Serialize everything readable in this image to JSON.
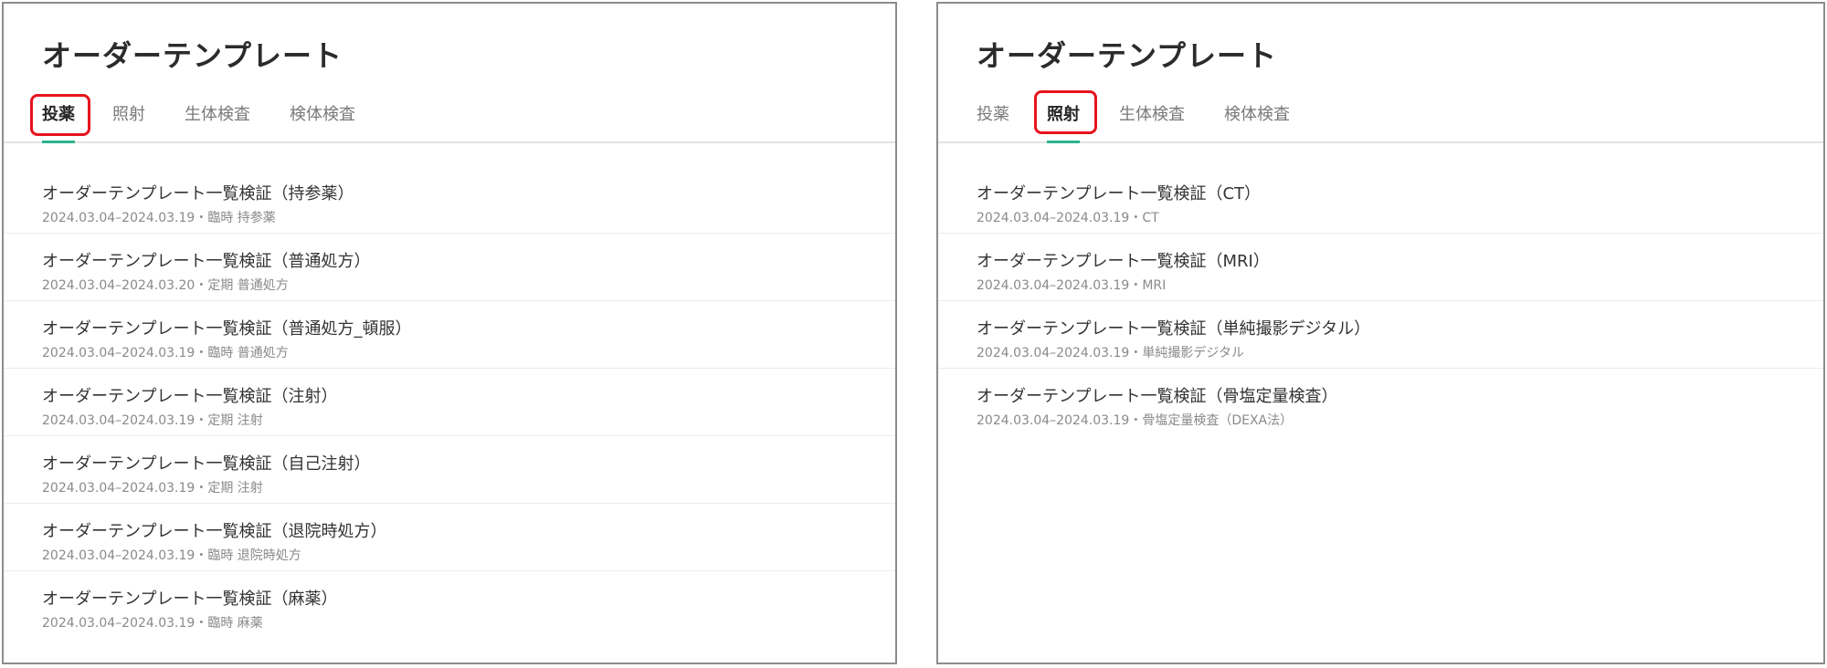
{
  "colors": {
    "accent": "#2bb38f",
    "highlight": "#e6141e",
    "border": "#8c8c8c"
  },
  "panels": [
    {
      "title": "オーダーテンプレート",
      "active_tab": "投薬",
      "tabs": [
        "投薬",
        "照射",
        "生体検査",
        "検体検査"
      ],
      "items": [
        {
          "title": "オーダーテンプレート一覧検証（持参薬）",
          "meta": "2024.03.04–2024.03.19・臨時 持参薬"
        },
        {
          "title": "オーダーテンプレート一覧検証（普通処方）",
          "meta": "2024.03.04–2024.03.20・定期 普通処方"
        },
        {
          "title": "オーダーテンプレート一覧検証（普通処方_頓服）",
          "meta": "2024.03.04–2024.03.19・臨時 普通処方"
        },
        {
          "title": "オーダーテンプレート一覧検証（注射）",
          "meta": "2024.03.04–2024.03.19・定期 注射"
        },
        {
          "title": "オーダーテンプレート一覧検証（自己注射）",
          "meta": "2024.03.04–2024.03.19・定期 注射"
        },
        {
          "title": "オーダーテンプレート一覧検証（退院時処方）",
          "meta": "2024.03.04–2024.03.19・臨時 退院時処方"
        },
        {
          "title": "オーダーテンプレート一覧検証（麻薬）",
          "meta": "2024.03.04–2024.03.19・臨時 麻薬"
        }
      ]
    },
    {
      "title": "オーダーテンプレート",
      "active_tab": "照射",
      "tabs": [
        "投薬",
        "照射",
        "生体検査",
        "検体検査"
      ],
      "items": [
        {
          "title": "オーダーテンプレート一覧検証（CT）",
          "meta": "2024.03.04–2024.03.19・CT"
        },
        {
          "title": "オーダーテンプレート一覧検証（MRI）",
          "meta": "2024.03.04–2024.03.19・MRI"
        },
        {
          "title": "オーダーテンプレート一覧検証（単純撮影デジタル）",
          "meta": "2024.03.04–2024.03.19・単純撮影デジタル"
        },
        {
          "title": "オーダーテンプレート一覧検証（骨塩定量検査）",
          "meta": "2024.03.04–2024.03.19・骨塩定量検査（DEXA法）"
        }
      ]
    }
  ]
}
